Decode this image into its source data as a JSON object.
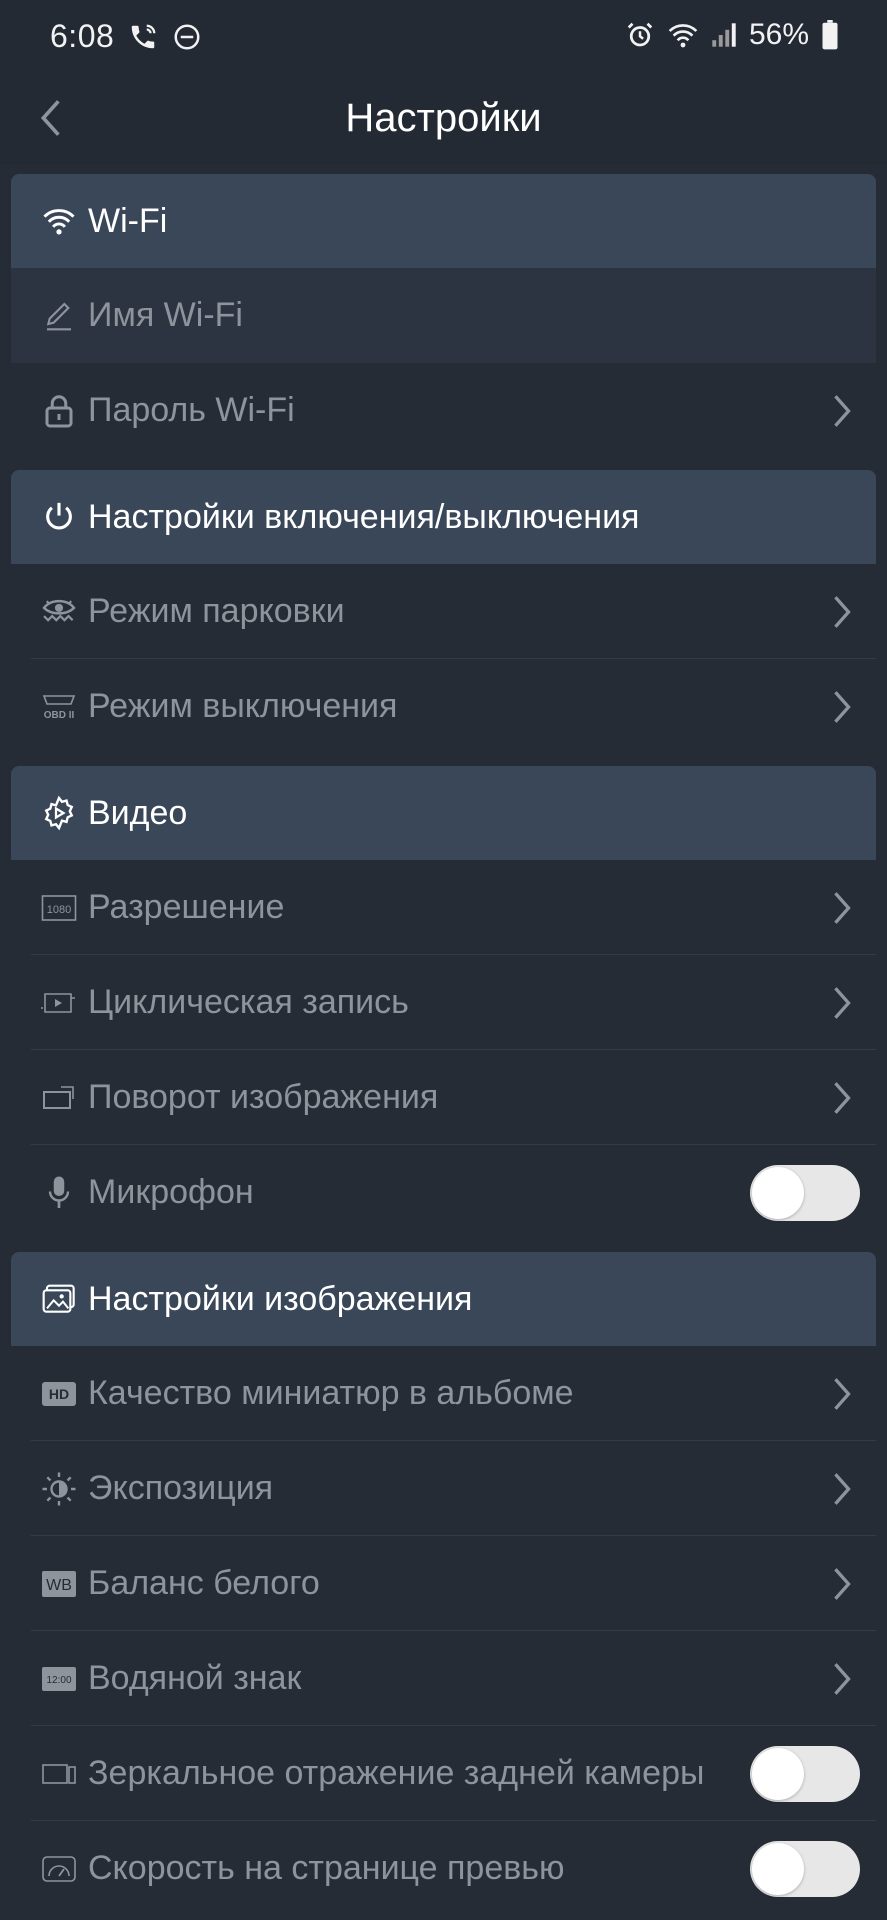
{
  "status_bar": {
    "time": "6:08",
    "battery": "56%",
    "icons": [
      "phone-call-icon",
      "do-not-disturb-icon",
      "alarm-icon",
      "wifi-icon",
      "signal-icon",
      "battery-icon"
    ]
  },
  "header": {
    "title": "Настройки",
    "back_icon": "chevron-left-icon"
  },
  "sections": {
    "wifi": {
      "title": "Wi-Fi",
      "icon": "wifi-icon",
      "items": [
        {
          "label": "Имя Wi-Fi",
          "icon": "pencil-icon"
        },
        {
          "label": "Пароль Wi-Fi",
          "icon": "lock-icon"
        }
      ]
    },
    "power": {
      "title": "Настройки включения/выключения",
      "icon": "power-icon",
      "items": [
        {
          "label": "Режим парковки",
          "icon": "parking-eye-icon"
        },
        {
          "label": "Режим выключения",
          "icon": "obd-icon",
          "icon_text": "OBD II"
        }
      ]
    },
    "video": {
      "title": "Видео",
      "icon": "gear-icon",
      "items": [
        {
          "label": "Разрешение",
          "icon": "resolution-icon",
          "icon_text": "1080"
        },
        {
          "label": "Циклическая запись",
          "icon": "loop-record-icon"
        },
        {
          "label": "Поворот изображения",
          "icon": "rotate-icon"
        },
        {
          "label": "Микрофон",
          "icon": "microphone-icon",
          "toggle_on": false
        }
      ]
    },
    "image": {
      "title": "Настройки изображения",
      "icon": "image-settings-icon",
      "items": [
        {
          "label": "Качество миниатюр в альбоме",
          "icon": "hd-icon",
          "icon_text": "HD"
        },
        {
          "label": "Экспозиция",
          "icon": "exposure-icon"
        },
        {
          "label": "Баланс белого",
          "icon": "wb-icon",
          "icon_text": "WB"
        },
        {
          "label": "Водяной знак",
          "icon": "watermark-icon",
          "icon_text": "12:00"
        },
        {
          "label": "Зеркальное отражение задней камеры",
          "icon": "mirror-icon",
          "toggle_on": false
        },
        {
          "label": "Скорость на странице превью",
          "icon": "speedometer-icon",
          "toggle_on": false
        }
      ]
    }
  },
  "colors": {
    "background": "#232a34",
    "section_header": "#3a4759",
    "label_muted": "#8e949c",
    "title_white": "#ffffff",
    "toggle_off": "#e7e7e7"
  }
}
